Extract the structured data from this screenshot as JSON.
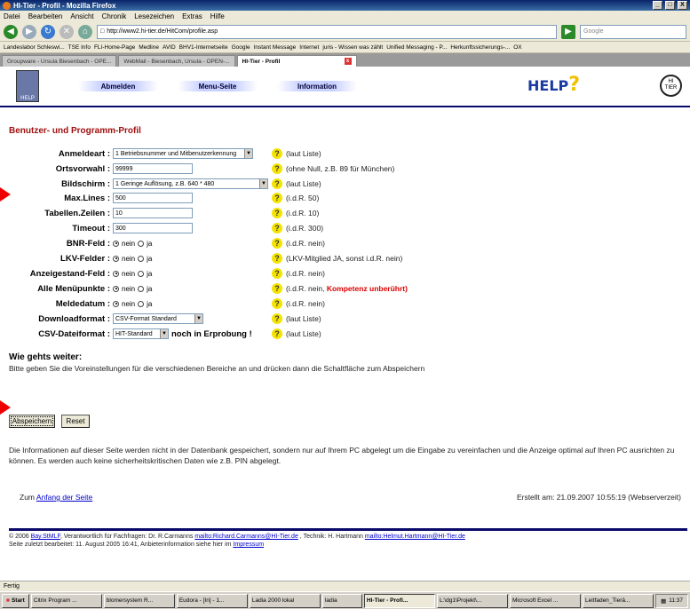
{
  "window": {
    "title": "HI-Tier - Profil - Mozilla Firefox",
    "min": "_",
    "max": "□",
    "close": "X"
  },
  "menu": [
    "Datei",
    "Bearbeiten",
    "Ansicht",
    "Chronik",
    "Lesezeichen",
    "Extras",
    "Hilfe"
  ],
  "nav": {
    "url": "http://www2.hi-tier.de/HitCom/profile.asp",
    "search_placeholder": "Google"
  },
  "bookmarks": [
    "Landeslabor Schleswi...",
    "TSE Info",
    "FLI-Home-Page",
    "Medline",
    "AVID",
    "BHV1-Internetseite",
    "Google",
    "Instant Message",
    "Internet",
    "juris - Wissen was zählt",
    "Unified Messaging - P...",
    "Herkunftssicherungs-...",
    "OX"
  ],
  "tabs": [
    {
      "label": "Groupware - Ursula Biesenbach - OPE..."
    },
    {
      "label": "WebMail - Biesenbach, Ursula - OPEN-..."
    },
    {
      "label": "HI-Tier - Profil",
      "active": true
    }
  ],
  "header": {
    "logo": "HELP",
    "nav": [
      "Abmelden",
      "Menu-Seite",
      "Information"
    ],
    "help": "HELP",
    "help_q": "?",
    "seal": "HI TIER"
  },
  "page_title": "Benutzer- und Programm-Profil",
  "fields": [
    {
      "label": "Anmeldeart :",
      "type": "select",
      "value": "1 Betriebsnummer und Mitbenutzerkennung",
      "hint": "(laut Liste)"
    },
    {
      "label": "Ortsvorwahl :",
      "type": "input",
      "value": "99999",
      "hint": "(ohne Null, z.B. 89 für München)"
    },
    {
      "label": "Bildschirm :",
      "type": "select",
      "value": "1 Geringe Auflösung, z.B. 640 * 480",
      "hint": "(laut Liste)"
    },
    {
      "label": "Max.Lines :",
      "type": "input",
      "value": "500",
      "hint": "(i.d.R. 50)"
    },
    {
      "label": "Tabellen.Zeilen :",
      "type": "input",
      "value": "10",
      "hint": "(i.d.R. 10)"
    },
    {
      "label": "Timeout :",
      "type": "input",
      "value": "300",
      "hint": "(i.d.R. 300)"
    },
    {
      "label": "BNR-Feld :",
      "type": "radio",
      "opt1": "nein",
      "opt2": "ja",
      "hint": "(i.d.R. nein)"
    },
    {
      "label": "LKV-Felder :",
      "type": "radio",
      "opt1": "nein",
      "opt2": "ja",
      "hint": "(LKV-Mitglied JA, sonst i.d.R. nein)"
    },
    {
      "label": "Anzeigestand-Feld :",
      "type": "radio",
      "opt1": "nein",
      "opt2": "ja",
      "hint": "(i.d.R. nein)"
    },
    {
      "label": "Alle Menüpunkte :",
      "type": "radio",
      "opt1": "nein",
      "opt2": "ja",
      "hint": "(i.d.R. nein, ",
      "warn": "Kompetenz unberührt)"
    },
    {
      "label": "Meldedatum :",
      "type": "radio",
      "opt1": "nein",
      "opt2": "ja",
      "hint": "(i.d.R. nein)"
    },
    {
      "label": "Downloadformat :",
      "type": "select",
      "value": "CSV-Format Standard",
      "hint": "(laut Liste)"
    },
    {
      "label": "CSV-Dateiformat :",
      "type": "select",
      "value": "HIT-Standard",
      "extra": "noch in Erprobung !",
      "hint": "(laut Liste)"
    }
  ],
  "howto": {
    "heading": "Wie gehts weiter:",
    "text": "Bitte geben Sie die Voreinstellungen für die verschiedenen Bereiche an und drücken dann die Schaltfläche zum Abspeichern"
  },
  "buttons": {
    "save": "Abspeichern",
    "reset": "Reset"
  },
  "info": "Die Informationen auf dieser Seite werden nicht in der Datenbank gespeichert, sondern nur auf Ihrem PC abgelegt um die Eingabe zu vereinfachen und die Anzeige optimal auf Ihren PC ausrichten zu können. Es werden auch keine sicherheitskritischen Daten wie z.B. PIN abgelegt.",
  "top_link": {
    "prefix": "Zum ",
    "link": "Anfang der Seite"
  },
  "created": "Erstellt am: 21.09.2007 10:55:19 (Webserverzeit)",
  "footer": {
    "l1a": "© 2006 ",
    "l1b": "Bay.StMLF",
    "l1c": ", Verantwortlich für Fachfragen: Dr. R.Carmanns ",
    "l1d": "mailto:Richard.Carmanns@HI-Tier.de",
    "l1e": " , Technik: H. Hartmann ",
    "l1f": "mailto:Helmut.Hartmann@HI-Tier.de",
    "l2a": "Seite zuletzt bearbeitet: 11. August 2005 16:41, Anbieterinformation siehe hier im ",
    "l2b": "Impressum"
  },
  "status": "Fertig",
  "taskbar": {
    "start": "Start",
    "items": [
      "Citrix Program ...",
      "blomersystem R...",
      "Eudora - [In] - 1...",
      "Ladia 2000 lokal",
      "ladia",
      "HI-Tier - Profi...",
      "L:\\dg1\\Projekt\\...",
      "Microsoft Excel ...",
      "Leitfaden_Tierä..."
    ],
    "clock": "11:37"
  }
}
